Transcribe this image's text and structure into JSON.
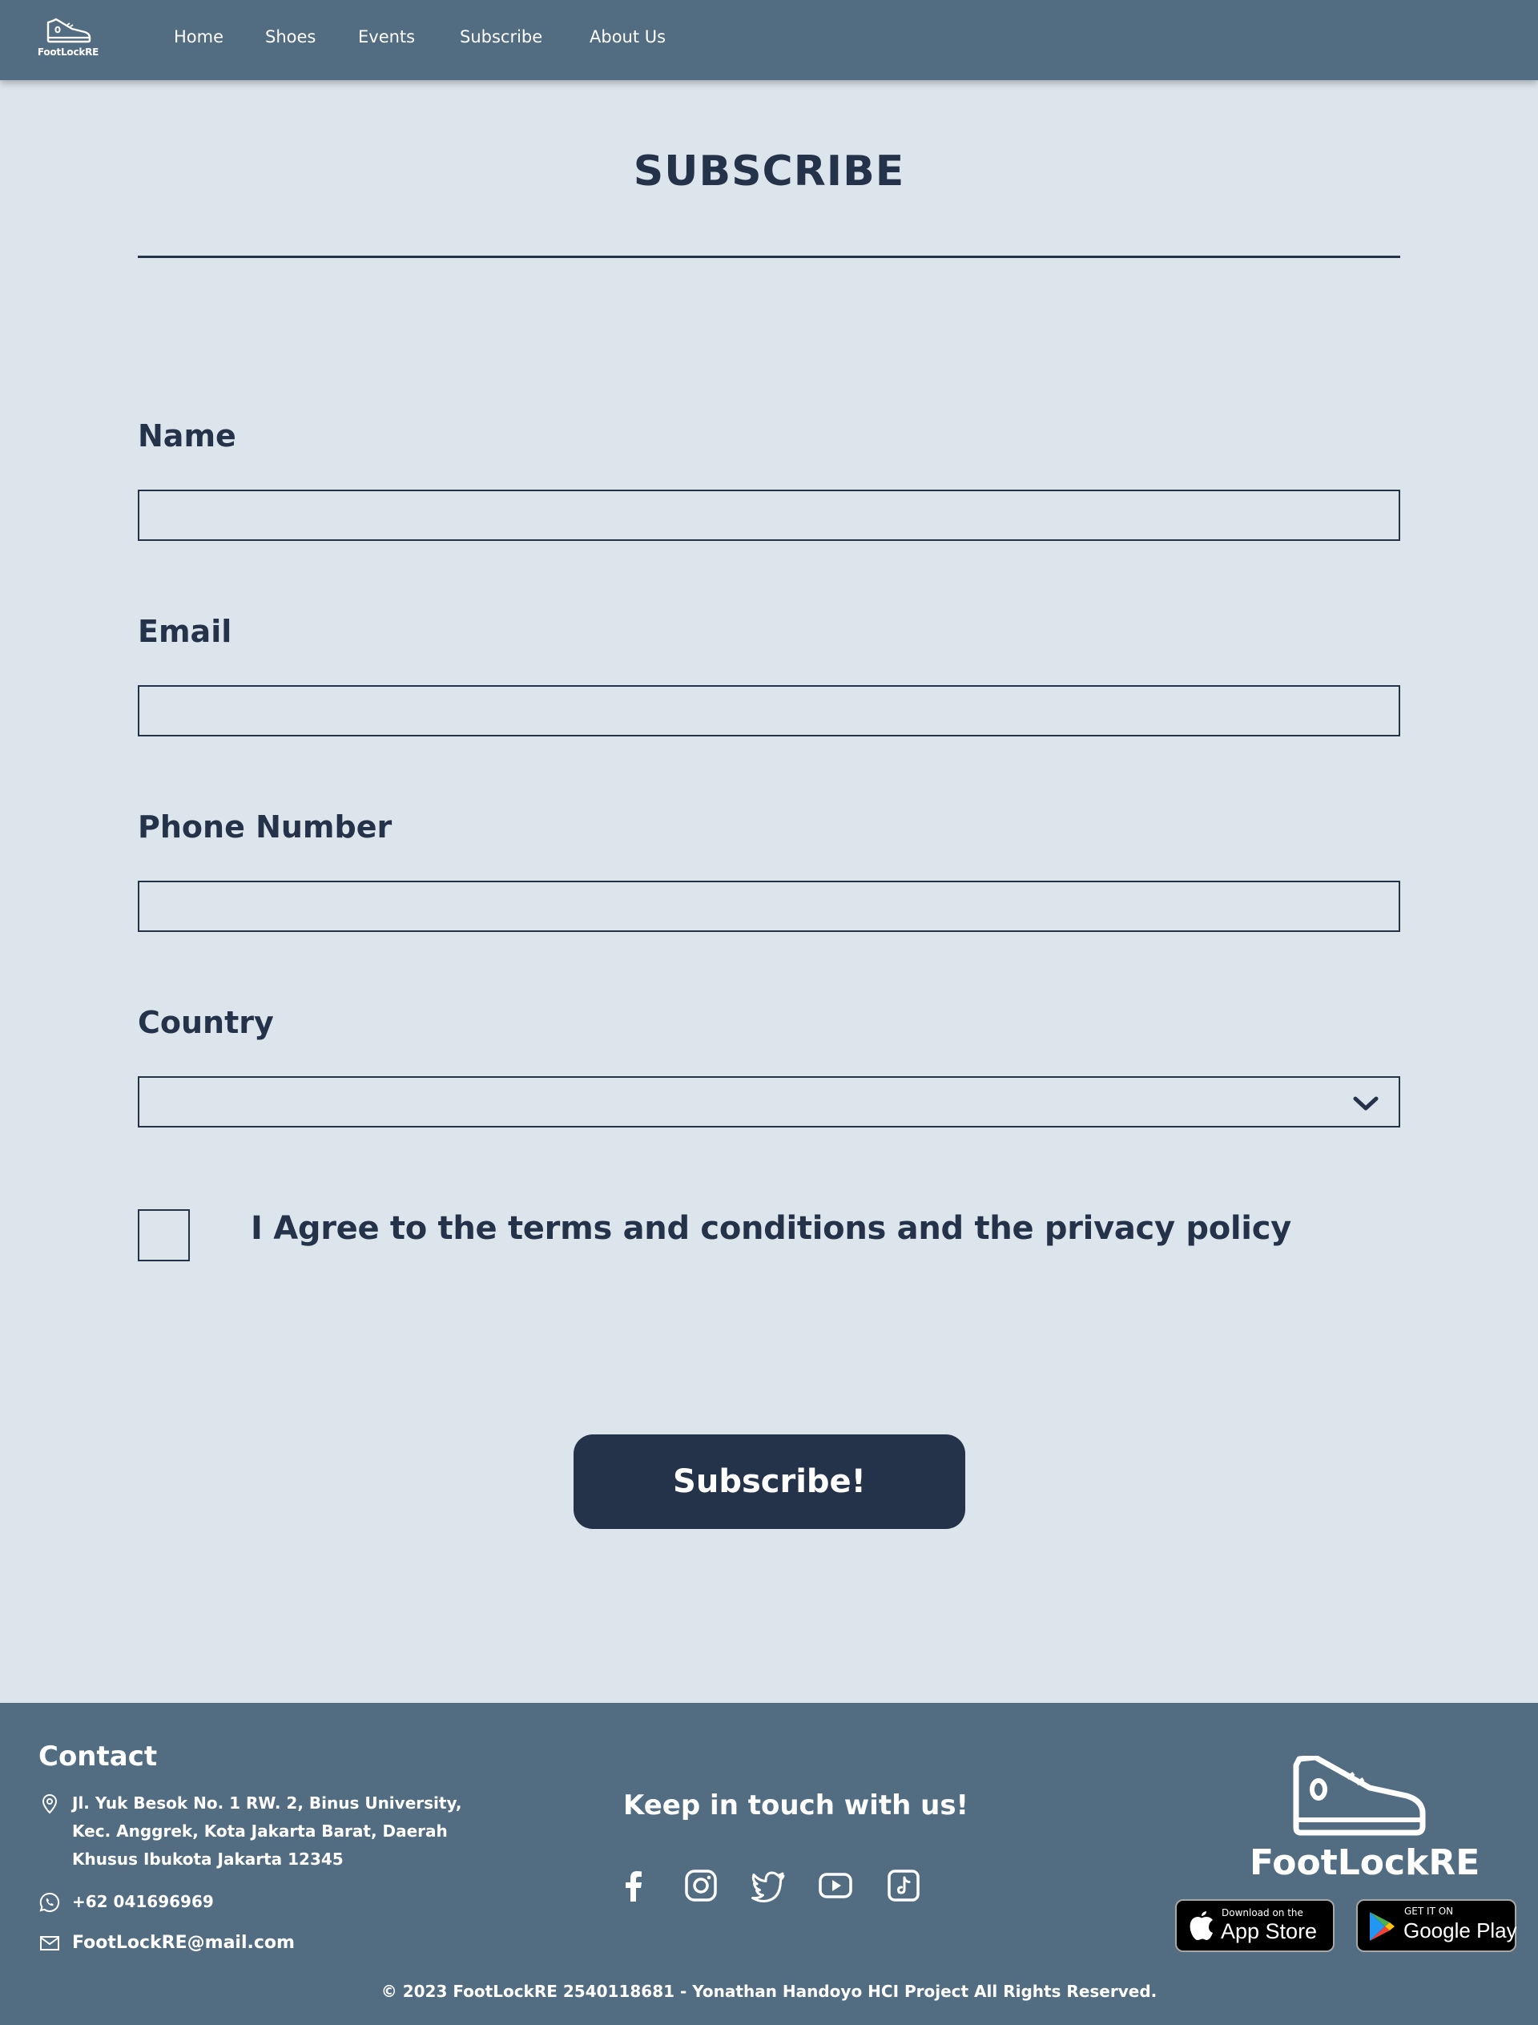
{
  "nav": {
    "logo_text": "FootLockRE",
    "links": [
      "Home",
      "Shoes",
      "Events",
      "Subscribe",
      "About Us"
    ]
  },
  "form": {
    "title": "SUBSCRIBE",
    "name_label": "Name",
    "name_value": "",
    "email_label": "Email",
    "email_value": "",
    "phone_label": "Phone Number",
    "phone_value": "",
    "country_label": "Country",
    "country_value": "",
    "agree_label": "I Agree to the terms and conditions and the privacy policy",
    "agree_checked": false,
    "submit_label": "Subscribe!"
  },
  "footer": {
    "contact_heading": "Contact",
    "address_lines": [
      "Jl. Yuk Besok No. 1 RW. 2, Binus University,",
      "Kec. Anggrek, Kota Jakarta Barat, Daerah",
      "Khusus Ibukota Jakarta 12345"
    ],
    "phone": "+62 041696969",
    "email": "FootLockRE@mail.com",
    "keep_in_touch": "Keep in touch with us!",
    "social_icons": [
      "facebook-icon",
      "instagram-icon",
      "twitter-icon",
      "youtube-icon",
      "tiktok-icon"
    ],
    "logo_text": "FootLockRE",
    "app_store_small": "Download on the",
    "app_store_big": "App Store",
    "google_play_small": "GET IT ON",
    "google_play_big": "Google Play",
    "copyright": "© 2023 FootLockRE 2540118681 - Yonathan Handoyo HCI Project All Rights Reserved."
  },
  "colors": {
    "page_bg": "#dde5ec",
    "nav_footer_bg": "#526c82",
    "primary_dark": "#25334a",
    "text_light": "#ffffff"
  }
}
